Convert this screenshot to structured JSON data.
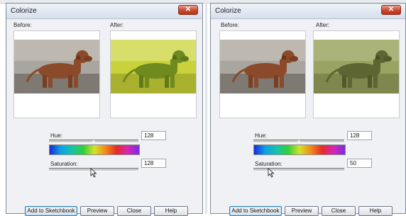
{
  "dialogs": [
    {
      "title": "Colorize",
      "close_glyph": "✕",
      "before_label": "Before:",
      "after_label": "After:",
      "hue_label": "Hue:",
      "hue_value": "128",
      "saturation_label": "Saturation:",
      "saturation_value": "128",
      "buttons": {
        "add": "Add to Sketchbook",
        "preview": "Preview",
        "close": "Close",
        "help": "Help"
      },
      "after_tint": "#c9d23a"
    },
    {
      "title": "Colorize",
      "close_glyph": "✕",
      "before_label": "Before:",
      "after_label": "After:",
      "hue_label": "Hue:",
      "hue_value": "128",
      "saturation_label": "Saturation:",
      "saturation_value": "50",
      "buttons": {
        "add": "Add to Sketchbook",
        "preview": "Preview",
        "close": "Close",
        "help": "Help"
      },
      "after_tint": "#9aa462"
    }
  ],
  "colors": {
    "dog_before": "#8b4a2a",
    "background_before": "#a9a6a0",
    "ground_before": "#7e7a73"
  }
}
